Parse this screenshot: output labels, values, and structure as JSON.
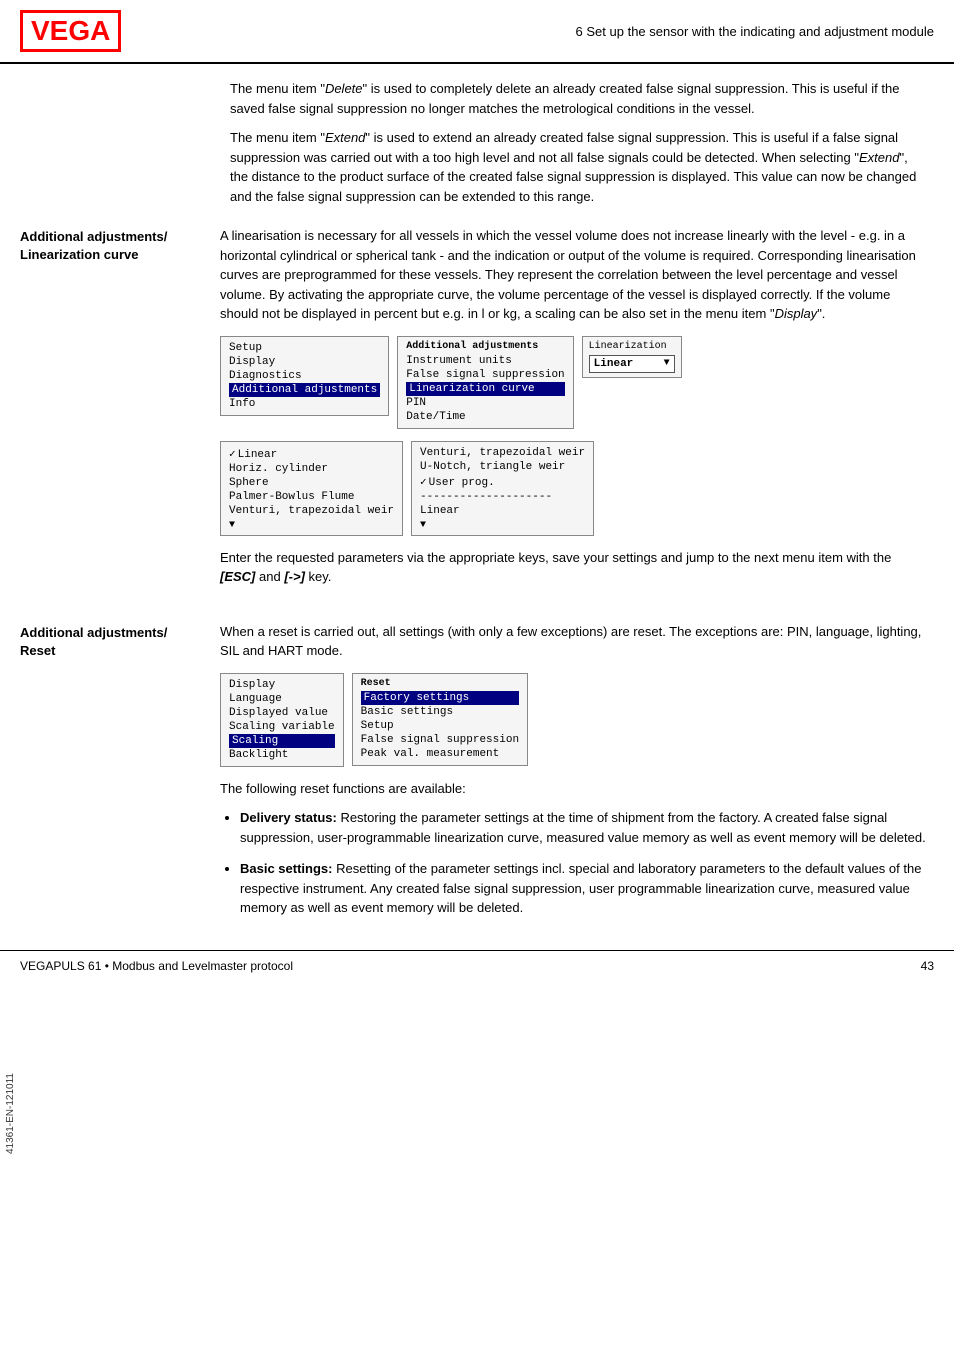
{
  "header": {
    "logo": "VEGA",
    "title": "6 Set up the sensor with the indicating and adjustment module"
  },
  "intro_paragraphs": {
    "p1_before_italic1": "The menu item \"",
    "p1_italic1": "Delete",
    "p1_after_italic1": "\" is used to completely delete an already created false signal suppression. This is useful if the saved false signal suppression no longer matches the metrological conditions in the vessel.",
    "p2_before_italic1": "The menu item \"",
    "p2_italic1": "Extend",
    "p2_after_italic1": "\" is used to extend an already created false signal suppression. This is useful if a false signal suppression was carried out with a too high level and not all false signals could be detected. When selecting \"",
    "p2_italic2": "Extend",
    "p2_after_italic2": "\", the distance to the product surface of the created false signal suppression is displayed. This value can now be changed and the false signal suppression can be extended to this range."
  },
  "linearization_section": {
    "sidebar_label_line1": "Additional adjustments/",
    "sidebar_label_line2": "Linearization curve",
    "description": "A linearisation is necessary for all vessels in which the vessel volume does not increase linearly with the level - e.g. in a horizontal cylindrical or spherical tank - and the indication or output of the volume is required. Corresponding linearisation curves are preprogrammed for these vessels. They represent the correlation between the level percentage and vessel volume. By activating the appropriate curve, the volume percentage of the vessel is displayed correctly. If the volume should not be displayed in percent but e.g. in l or kg, a scaling can be also set in the menu item \"",
    "description_italic": "Display",
    "description_end": "\".",
    "menu_box1": {
      "items": [
        "Setup",
        "Display",
        "Diagnostics",
        "Additional adjustments",
        "Info"
      ],
      "selected_index": 3
    },
    "menu_box2": {
      "header": "Additional adjustments",
      "items": [
        "Instrument units",
        "False signal suppression",
        "Linearization curve",
        "PIN",
        "Date/Time"
      ],
      "selected_index": 2
    },
    "dropdown_box": {
      "label": "Linearization",
      "selected_value": "Linear"
    },
    "menu_box3": {
      "items": [
        "Linear",
        "Horiz. cylinder",
        "Sphere",
        "Palmer-Bowlus Flume",
        "Venturi, trapezoidal weir"
      ],
      "checked_indices": [
        0
      ]
    },
    "menu_box4": {
      "items": [
        "Venturi, trapezoidal weir",
        "U-Notch, triangle weir",
        "User prog.",
        "--------------------",
        "Linear"
      ],
      "checked_indices": [
        2
      ]
    },
    "enter_text_before_esc": "Enter the requested parameters via the appropriate keys, save your settings and jump to the next menu item with the ",
    "esc_key": "[ESC]",
    "enter_text_between": " and ",
    "arrow_key": "[->]",
    "enter_text_after": " key."
  },
  "reset_section": {
    "sidebar_label_line1": "Additional adjustments/",
    "sidebar_label_line2": "Reset",
    "description": "When a reset is carried out, all settings (with only a few exceptions) are reset. The exceptions are: PIN, language, lighting, SIL and HART mode.",
    "menu_box1": {
      "items": [
        "Display",
        "Language",
        "Displayed value",
        "Scaling variable",
        "Scaling",
        "Backlight"
      ],
      "selected_index": 4
    },
    "menu_box2": {
      "header": "Reset",
      "items": [
        "Factory settings",
        "Basic settings",
        "Setup",
        "False signal suppression",
        "Peak val. measurement"
      ],
      "selected_index": 0
    },
    "following_text": "The following reset functions are available:",
    "bullets": [
      {
        "bold": "Delivery status:",
        "text": " Restoring the parameter settings at the time of shipment from the factory. A created false signal suppression, user-programmable linearization curve, measured value memory as well as event memory will be deleted."
      },
      {
        "bold": "Basic settings:",
        "text": " Resetting of the parameter settings incl. special and laboratory parameters to the default values of the respective instrument. Any created false signal suppression, user programmable linearization curve, measured value memory as well as event memory will be deleted."
      }
    ]
  },
  "footer": {
    "left": "VEGAPULS 61 • Modbus and Levelmaster protocol",
    "right": "43"
  },
  "vertical_text": "41361-EN-121011"
}
